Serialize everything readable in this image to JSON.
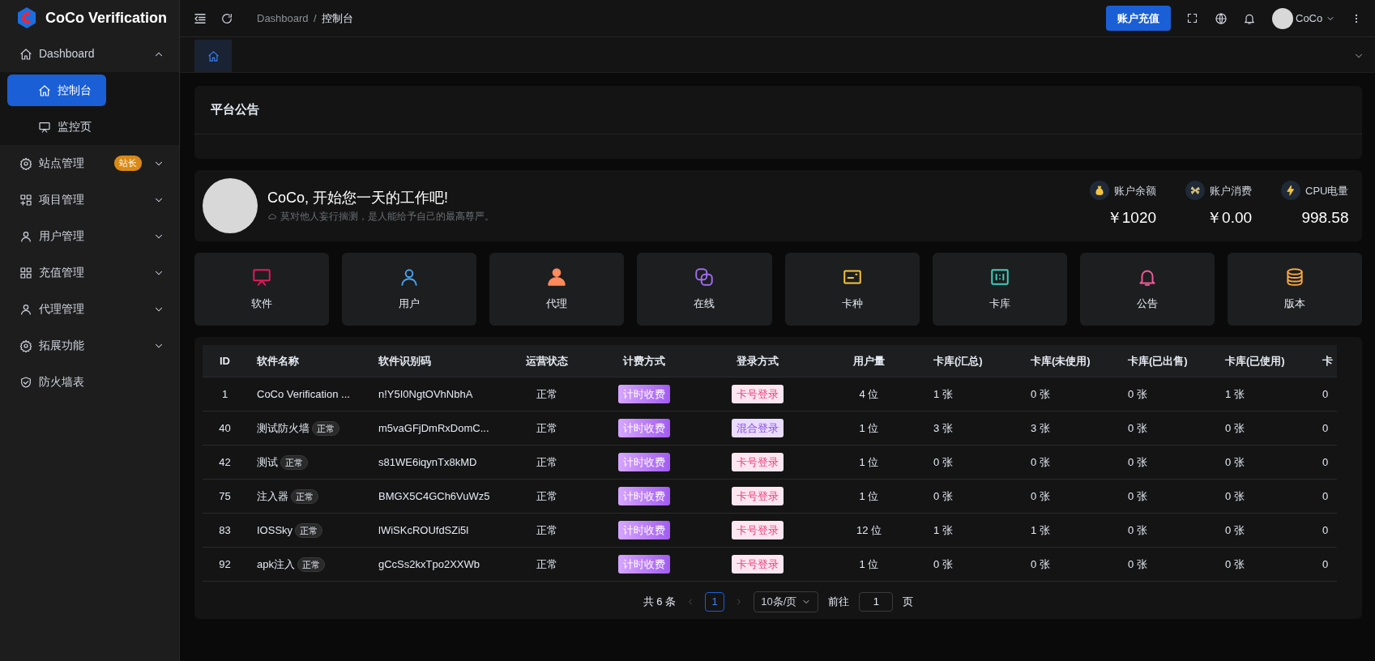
{
  "sidebar": {
    "logo_text": "CoCo Verification",
    "items": [
      {
        "label": "Dashboard",
        "selected": false,
        "expanded": true,
        "children": [
          {
            "label": "控制台",
            "selected": true
          },
          {
            "label": "监控页",
            "selected": false
          }
        ]
      },
      {
        "label": "站点管理",
        "selected": false,
        "expanded": false,
        "badge": "站长"
      },
      {
        "label": "项目管理",
        "selected": false,
        "expanded": false
      },
      {
        "label": "用户管理",
        "selected": false,
        "expanded": false
      },
      {
        "label": "充值管理",
        "selected": false,
        "expanded": false
      },
      {
        "label": "代理管理",
        "selected": false,
        "expanded": false
      },
      {
        "label": "拓展功能",
        "selected": false,
        "expanded": false
      },
      {
        "label": "防火墙表",
        "selected": false
      }
    ]
  },
  "header": {
    "breadcrumb": [
      "Dashboard",
      "控制台"
    ],
    "separator": "/",
    "recharge_button": "账户充值",
    "user_name": "CoCo"
  },
  "tabs": [
    {
      "selected": true
    }
  ],
  "announcement": {
    "title": "平台公告"
  },
  "welcome": {
    "greeting": "CoCo, 开始您一天的工作吧!",
    "motto": "莫对他人妄行揣测，是人能给予自己的最高尊严。",
    "stats": [
      {
        "label": "账户余额",
        "value": "￥1020"
      },
      {
        "label": "账户消费",
        "value": "￥0.00"
      },
      {
        "label": "CPU电量",
        "value": "998.58"
      }
    ]
  },
  "shortcuts": [
    {
      "label": "软件",
      "color": "#e8175d"
    },
    {
      "label": "用户",
      "color": "#4aa3f0"
    },
    {
      "label": "代理",
      "color": "#ff8a5c"
    },
    {
      "label": "在线",
      "color": "#a06cf0"
    },
    {
      "label": "卡种",
      "color": "#f5c542"
    },
    {
      "label": "卡库",
      "color": "#3fd0c0"
    },
    {
      "label": "公告",
      "color": "#f05a9a"
    },
    {
      "label": "版本",
      "color": "#f5a742"
    }
  ],
  "table": {
    "columns": [
      "ID",
      "软件名称",
      "软件识别码",
      "运营状态",
      "计费方式",
      "登录方式",
      "用户量",
      "卡库(汇总)",
      "卡库(未使用)",
      "卡库(已出售)",
      "卡库(已使用)",
      "卡"
    ],
    "rows": [
      {
        "id": "1",
        "name": "CoCo Verification ...",
        "code": "n!Y5I0NgtOVhNbhA",
        "status": "正常",
        "billing": "计时收费",
        "login": {
          "label": "卡号登录",
          "kind": "card"
        },
        "users": "4 位",
        "k_total": "1 张",
        "k_unused": "0 张",
        "k_sold": "0 张",
        "k_used": "1 张",
        "column_12": "0"
      },
      {
        "id": "40",
        "name": "测试防火墙",
        "tag": "正常",
        "code": "m5vaGFjDmRxDomC...",
        "status": "正常",
        "billing": "计时收费",
        "login": {
          "label": "混合登录",
          "kind": "mixed"
        },
        "users": "1 位",
        "k_total": "3 张",
        "k_unused": "3 张",
        "k_sold": "0 张",
        "k_used": "0 张",
        "column_12": "0"
      },
      {
        "id": "42",
        "name": "测试",
        "tag": "正常",
        "code": "s81WE6iqynTx8kMD",
        "status": "正常",
        "billing": "计时收费",
        "login": {
          "label": "卡号登录",
          "kind": "card"
        },
        "users": "1 位",
        "k_total": "0 张",
        "k_unused": "0 张",
        "k_sold": "0 张",
        "k_used": "0 张",
        "column_12": "0"
      },
      {
        "id": "75",
        "name": "注入器",
        "tag": "正常",
        "code": "BMGX5C4GCh6VuWz5",
        "status": "正常",
        "billing": "计时收费",
        "login": {
          "label": "卡号登录",
          "kind": "card"
        },
        "users": "1 位",
        "k_total": "0 张",
        "k_unused": "0 张",
        "k_sold": "0 张",
        "k_used": "0 张",
        "column_12": "0"
      },
      {
        "id": "83",
        "name": "IOSSky",
        "tag": "正常",
        "code": "lWiSKcROUfdSZi5l",
        "status": "正常",
        "billing": "计时收费",
        "login": {
          "label": "卡号登录",
          "kind": "card"
        },
        "users": "12 位",
        "k_total": "1 张",
        "k_unused": "1 张",
        "k_sold": "0 张",
        "k_used": "0 张",
        "column_12": "0"
      },
      {
        "id": "92",
        "name": "apk注入",
        "tag": "正常",
        "code": "gCcSs2kxTpo2XXWb",
        "status": "正常",
        "billing": "计时收费",
        "login": {
          "label": "卡号登录",
          "kind": "card"
        },
        "users": "1 位",
        "k_total": "0 张",
        "k_unused": "0 张",
        "k_sold": "0 张",
        "k_used": "0 张",
        "column_12": "0"
      }
    ]
  },
  "pagination": {
    "total": "共 6 条",
    "pages": [
      {
        "label": "1",
        "selected": true
      }
    ],
    "page_size": "10条/页",
    "goto_label": "前往",
    "goto_value": "1",
    "goto_suffix": "页"
  }
}
